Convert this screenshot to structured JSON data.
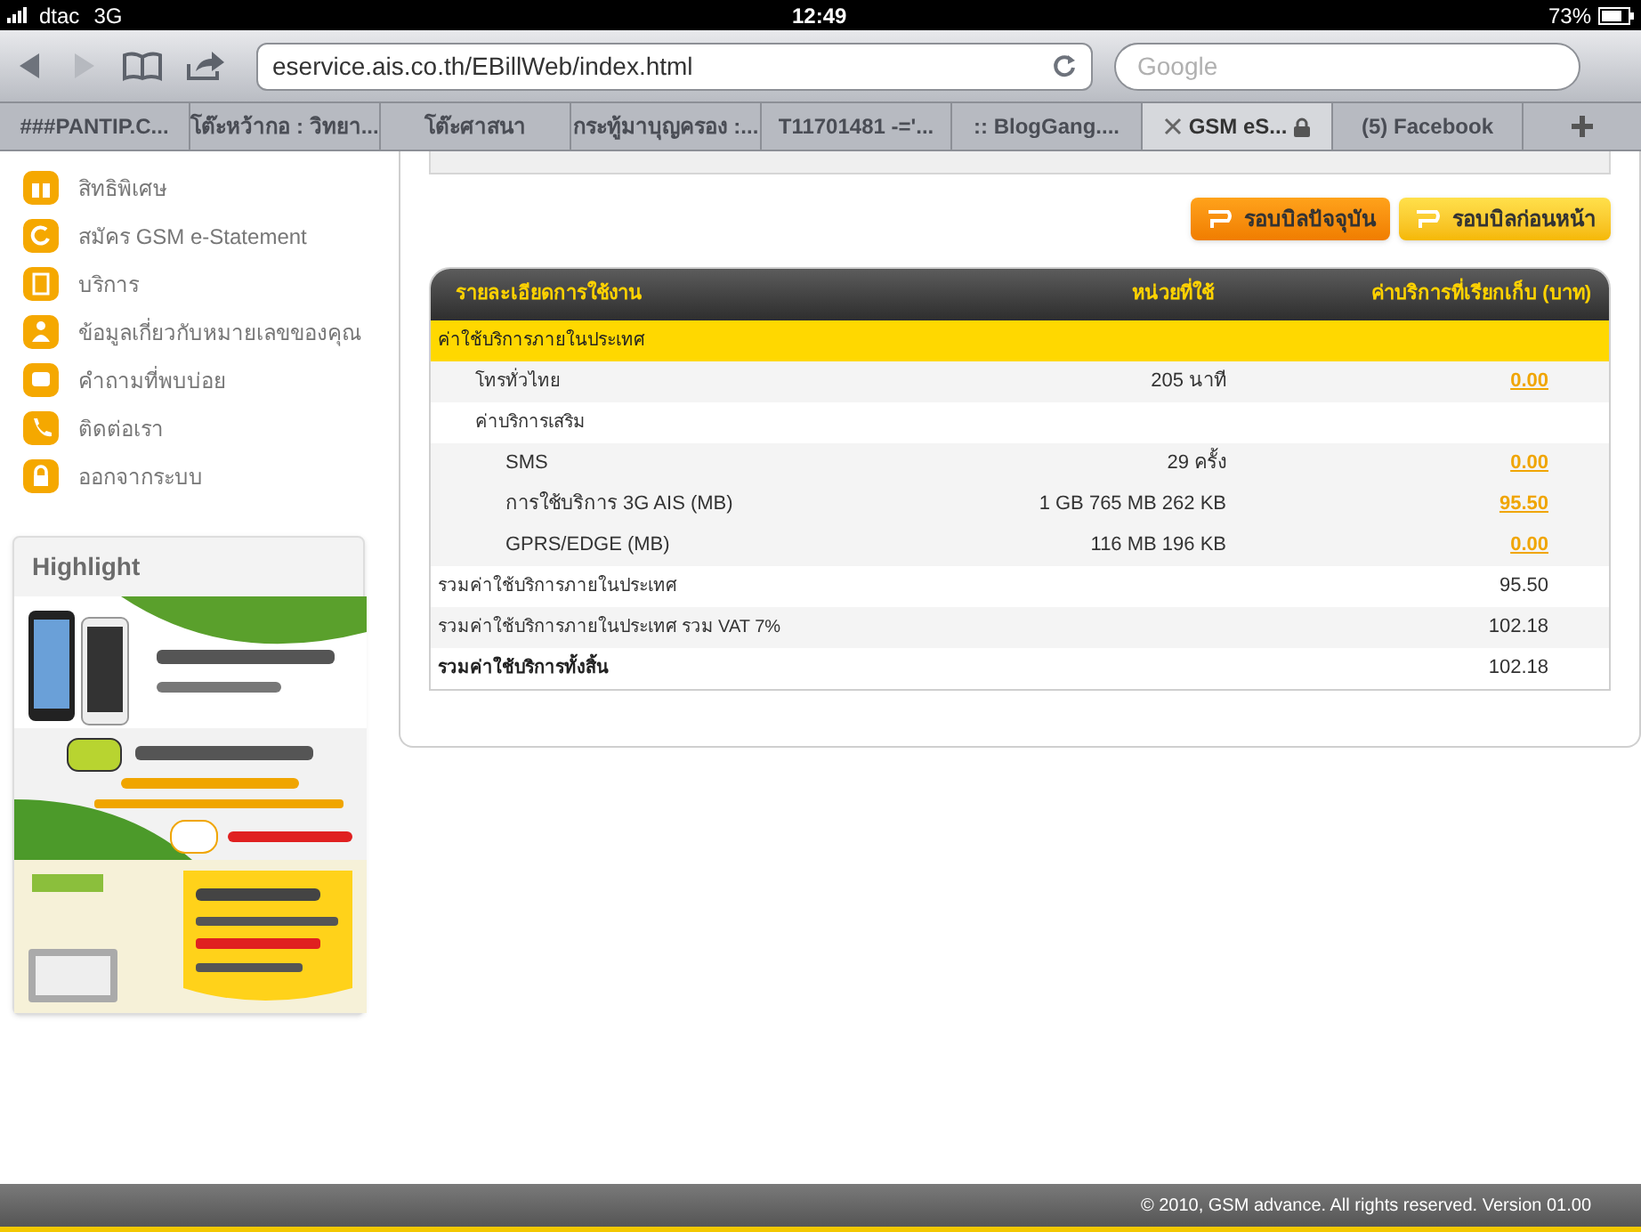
{
  "status_bar": {
    "carrier": "dtac",
    "network": "3G",
    "time": "12:49",
    "battery": "73%"
  },
  "browser": {
    "url": "eservice.ais.co.th/EBillWeb/index.html",
    "search_placeholder": "Google"
  },
  "tabs": [
    {
      "label": "###PANTIP.C...",
      "selected": false
    },
    {
      "label": "โต๊ะหว้ากอ : วิทยา...",
      "selected": false
    },
    {
      "label": "โต๊ะศาสนา",
      "selected": false
    },
    {
      "label": "กระทู้มาบุญครอง :...",
      "selected": false
    },
    {
      "label": "T11701481 -='...",
      "selected": false
    },
    {
      "label": ":: BlogGang....",
      "selected": false
    },
    {
      "label": "GSM eS...",
      "selected": true,
      "secure": true
    },
    {
      "label": "(5) Facebook",
      "selected": false
    }
  ],
  "sidebar": {
    "items": [
      {
        "label": "สิทธิพิเศษ"
      },
      {
        "label": "สมัคร GSM e-Statement"
      },
      {
        "label": "บริการ"
      },
      {
        "label": "ข้อมูลเกี่ยวกับหมายเลขของคุณ"
      },
      {
        "label": "คำถามที่พบบ่อย"
      },
      {
        "label": "ติดต่อเรา"
      },
      {
        "label": "ออกจากระบบ"
      }
    ],
    "highlight": {
      "title": "Highlight"
    }
  },
  "bill_buttons": [
    {
      "label": "รอบบิลปัจจุบัน",
      "selected": true
    },
    {
      "label": "รอบบิลก่อนหน้า",
      "selected": false
    }
  ],
  "table": {
    "columns": [
      "รายละเอียดการใช้งาน",
      "หน่วยที่ใช้",
      "ค่าบริการที่เรียกเก็บ (บาท)"
    ],
    "rows": [
      {
        "kind": "section",
        "label": "ค่าใช้บริการภายในประเทศ"
      },
      {
        "kind": "item",
        "label": "โทรทั่วไทย",
        "units": "205 นาที",
        "amount": "0.00",
        "link": true
      },
      {
        "kind": "group",
        "label": "ค่าบริการเสริม"
      },
      {
        "kind": "subitem",
        "label": "SMS",
        "units": "29 ครั้ง",
        "amount": "0.00",
        "link": true
      },
      {
        "kind": "subitem",
        "label": "การใช้บริการ 3G AIS (MB)",
        "units": "1 GB 765 MB 262 KB",
        "amount": "95.50",
        "link": true
      },
      {
        "kind": "subitem",
        "label": "GPRS/EDGE (MB)",
        "units": "116 MB 196 KB",
        "amount": "0.00",
        "link": true
      },
      {
        "kind": "total",
        "label": "รวมค่าใช้บริการภายในประเทศ",
        "amount": "95.50",
        "link": false
      },
      {
        "kind": "total",
        "label": "รวมค่าใช้บริการภายในประเทศ รวม VAT 7%",
        "amount": "102.18",
        "link": false
      },
      {
        "kind": "grand_total",
        "label": "รวมค่าใช้บริการทั้งสิ้น",
        "amount": "102.18",
        "link": false
      }
    ]
  },
  "footer": "© 2010, GSM advance. All rights reserved. Version 01.00"
}
